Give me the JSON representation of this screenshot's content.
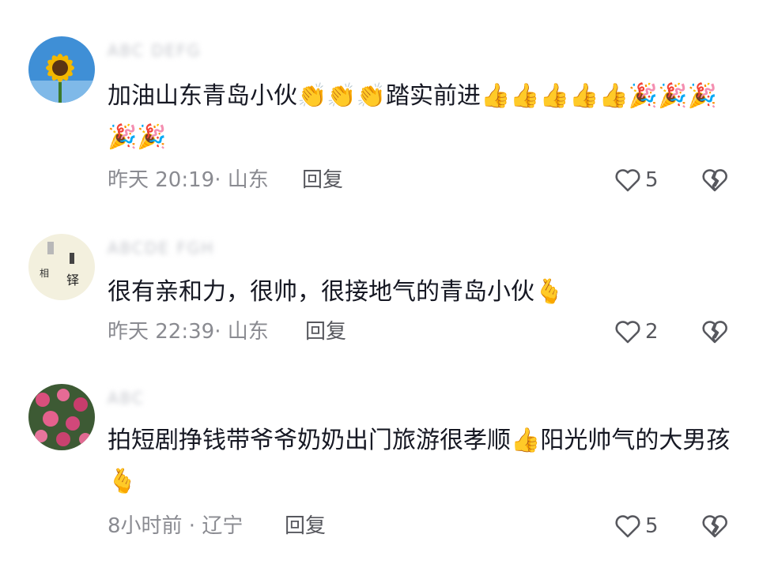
{
  "comments": [
    {
      "username": "ABC DEFG",
      "avatar": "sunflower-avatar",
      "text": "加油山东青岛小伙👏👏👏踏实前进👍👍👍👍👍🎉🎉🎉🎉🎉",
      "meta": "昨天 20:19· 山东",
      "reply_label": "回复",
      "likes": "5"
    },
    {
      "username": "ABCDE FGH",
      "avatar": "calligraphy-avatar",
      "text": "很有亲和力，很帅，很接地气的青岛小伙🫰",
      "meta": "昨天 22:39· 山东",
      "reply_label": "回复",
      "likes": "2"
    },
    {
      "username": "ABC",
      "avatar": "pink-flowers-avatar",
      "text": "拍短剧挣钱带爷爷奶奶出门旅游很孝顺👍阳光帅气的大男孩🫰",
      "meta": "8小时前 · 辽宁",
      "reply_label": "回复",
      "likes": "5"
    }
  ],
  "icons": {
    "like": "heart-outline-icon",
    "dislike": "broken-heart-icon"
  },
  "colors": {
    "text": "#161823",
    "meta": "#8a8b91",
    "action": "#57585e"
  }
}
